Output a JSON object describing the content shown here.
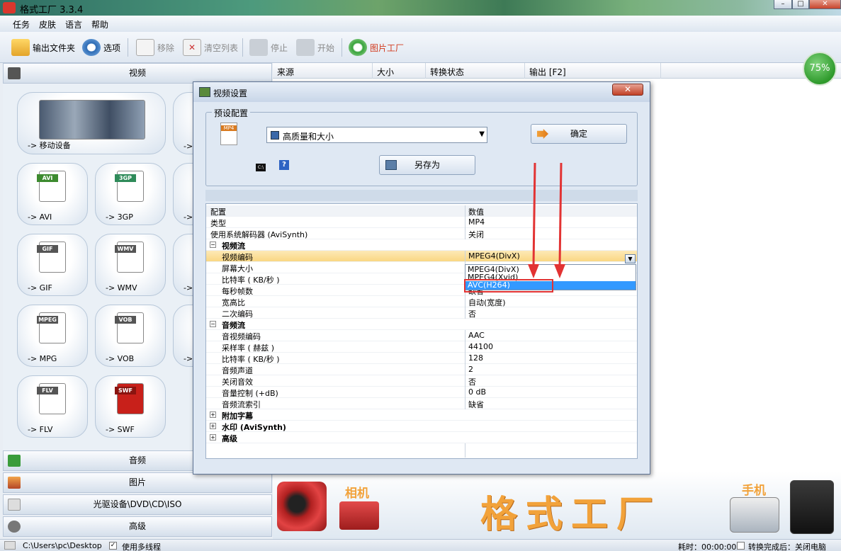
{
  "window": {
    "title": "格式工厂 3.3.4"
  },
  "menu": [
    "任务",
    "皮肤",
    "语言",
    "帮助"
  ],
  "toolbar": {
    "output_folder": "输出文件夹",
    "options": "选项",
    "remove": "移除",
    "clear": "清空列表",
    "stop": "停止",
    "start": "开始",
    "picture_factory": "图片工厂"
  },
  "left": {
    "video": "视频",
    "audio": "音频",
    "picture": "图片",
    "optical": "光驱设备\\DVD\\CD\\ISO",
    "advanced": "高级",
    "cards": [
      {
        "label": "-> 移动设备",
        "tag": ""
      },
      {
        "label": "->",
        "tag": ""
      },
      {
        "label": "-> AVI",
        "tag": "AVI"
      },
      {
        "label": "-> 3GP",
        "tag": "3GP"
      },
      {
        "label": "->",
        "tag": ""
      },
      {
        "label": "-> GIF",
        "tag": "GIF"
      },
      {
        "label": "-> WMV",
        "tag": "WMV"
      },
      {
        "label": "->",
        "tag": ""
      },
      {
        "label": "-> MPG",
        "tag": "MPEG"
      },
      {
        "label": "-> VOB",
        "tag": "VOB"
      },
      {
        "label": "->",
        "tag": ""
      },
      {
        "label": "-> FLV",
        "tag": "FLV"
      },
      {
        "label": "-> SWF",
        "tag": "SWF"
      }
    ]
  },
  "table": {
    "source": "来源",
    "size": "大小",
    "state": "转换状态",
    "output": "输出 [F2]"
  },
  "progress": "75%",
  "banner": {
    "camera": "相机",
    "brand": "格式工厂",
    "phone": "手机"
  },
  "status": {
    "path": "C:\\Users\\pc\\Desktop",
    "multithread": "使用多线程",
    "elapsed": "耗时：00:00:00",
    "after": "转换完成后：关闭电脑"
  },
  "dialog": {
    "title": "视频设置",
    "preset_legend": "预设配置",
    "preset_value": "高质量和大小",
    "ok": "确定",
    "save_as": "另存为",
    "col_key": "配置",
    "col_val": "数值",
    "rows": [
      {
        "k": "类型",
        "v": "MP4"
      },
      {
        "k": "使用系统解码器 (AviSynth)",
        "v": "关闭"
      },
      {
        "k": "视频流",
        "v": ""
      },
      {
        "k": "视频编码",
        "v": "MPEG4(DivX)"
      },
      {
        "k": "屏幕大小",
        "v": ""
      },
      {
        "k": "比特率 ( KB/秒 )",
        "v": ""
      },
      {
        "k": "每秒帧数",
        "v": "缺省"
      },
      {
        "k": "宽高比",
        "v": "自动(宽度)"
      },
      {
        "k": "二次编码",
        "v": "否"
      },
      {
        "k": "音频流",
        "v": ""
      },
      {
        "k": "音视频编码",
        "v": "AAC"
      },
      {
        "k": "采样率 ( 赫兹 )",
        "v": "44100"
      },
      {
        "k": "比特率 ( KB/秒 )",
        "v": "128"
      },
      {
        "k": "音频声道",
        "v": "2"
      },
      {
        "k": "关闭音效",
        "v": "否"
      },
      {
        "k": "音量控制 (+dB)",
        "v": "0 dB"
      },
      {
        "k": "音频流索引",
        "v": "缺省"
      },
      {
        "k": "附加字幕",
        "v": ""
      },
      {
        "k": "水印 (AviSynth)",
        "v": ""
      },
      {
        "k": "高级",
        "v": ""
      }
    ],
    "dropdown": [
      "MPEG4(DivX)",
      "MPEG4(Xvid)",
      "AVC(H264)"
    ]
  },
  "colors": {
    "brand": "#f2a23a",
    "arrow": "#e23333",
    "select_blue": "#3399ff"
  }
}
